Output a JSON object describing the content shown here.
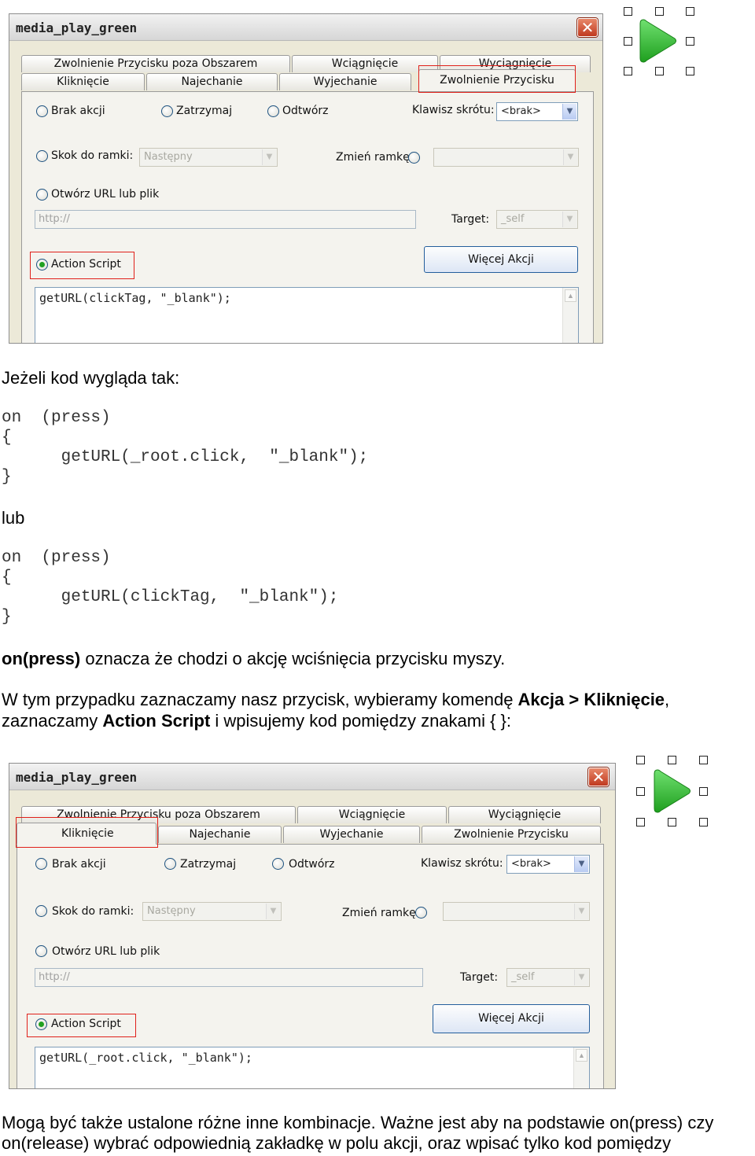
{
  "screenshot1": {
    "title": "media_play_green",
    "close": "✕",
    "tabs_top": [
      "Zwolnienie Przycisku poza Obszarem",
      "Wciągnięcie",
      "Wyciągnięcie"
    ],
    "tabs_bottom": [
      "Kliknięcie",
      "Najechanie",
      "Wyjechanie",
      "Zwolnienie Przycisku"
    ],
    "radio_none": "Brak akcji",
    "radio_stop": "Zatrzymaj",
    "radio_play": "Odtwórz",
    "shortcut_label": "Klawisz skrótu:",
    "shortcut_value": "<brak>",
    "radio_goto": "Skok do ramki:",
    "goto_value": "Następny",
    "change_frame_label": "Zmień ramkę:",
    "radio_url": "Otwórz URL lub plik",
    "url_placeholder": "http://",
    "target_label": "Target:",
    "target_value": "_self",
    "radio_actionscript": "Action Script",
    "more_actions": "Więcej Akcji",
    "code": "getURL(clickTag, \"_blank\");"
  },
  "screenshot2": {
    "title": "media_play_green",
    "close": "✕",
    "tabs_top": [
      "Zwolnienie Przycisku poza Obszarem",
      "Wciągnięcie",
      "Wyciągnięcie"
    ],
    "tabs_bottom": [
      "Kliknięcie",
      "Najechanie",
      "Wyjechanie",
      "Zwolnienie Przycisku"
    ],
    "radio_none": "Brak akcji",
    "radio_stop": "Zatrzymaj",
    "radio_play": "Odtwórz",
    "shortcut_label": "Klawisz skrótu:",
    "shortcut_value": "<brak>",
    "radio_goto": "Skok do ramki:",
    "goto_value": "Następny",
    "change_frame_label": "Zmień ramkę:",
    "radio_url": "Otwórz URL lub plik",
    "url_placeholder": "http://",
    "target_label": "Target:",
    "target_value": "_self",
    "radio_actionscript": "Action Script",
    "more_actions": "Więcej Akcji",
    "code": "getURL(_root.click, \"_blank\");"
  },
  "article": {
    "intro": "Jeżeli kod wygląda tak:",
    "code1": [
      "on  (press)",
      "{",
      "      getURL(_root.click,  \"_blank\");",
      "}"
    ],
    "or": "lub",
    "code2": [
      "on  (press)",
      "{",
      "      getURL(clickTag,  \"_blank\");",
      "}"
    ],
    "p1_bold": "on(press)",
    "p1_rest": " oznacza że chodzi o akcję wciśnięcia przycisku myszy.",
    "p2_a": "W tym przypadku zaznaczamy nasz przycisk, wybieramy komendę ",
    "p2_b": "Akcja > Kliknięcie",
    "p2_c": ",",
    "p3_a": "zaznaczamy ",
    "p3_b": "Action Script",
    "p3_c": " i wpisujemy kod pomiędzy znakami { }:",
    "p4_line1": "Mogą być także ustalone różne inne kombinacje. Ważne jest aby na podstawie on(press) czy",
    "p4_line2": "on(release) wybrać odpowiednią zakładkę w polu akcji, oraz wpisać tylko kod pomiędzy"
  },
  "colors": {
    "highlight": "#e0201a",
    "play_icon": "#3cc43c"
  },
  "icons": [
    "play-icon",
    "selection-handle"
  ]
}
